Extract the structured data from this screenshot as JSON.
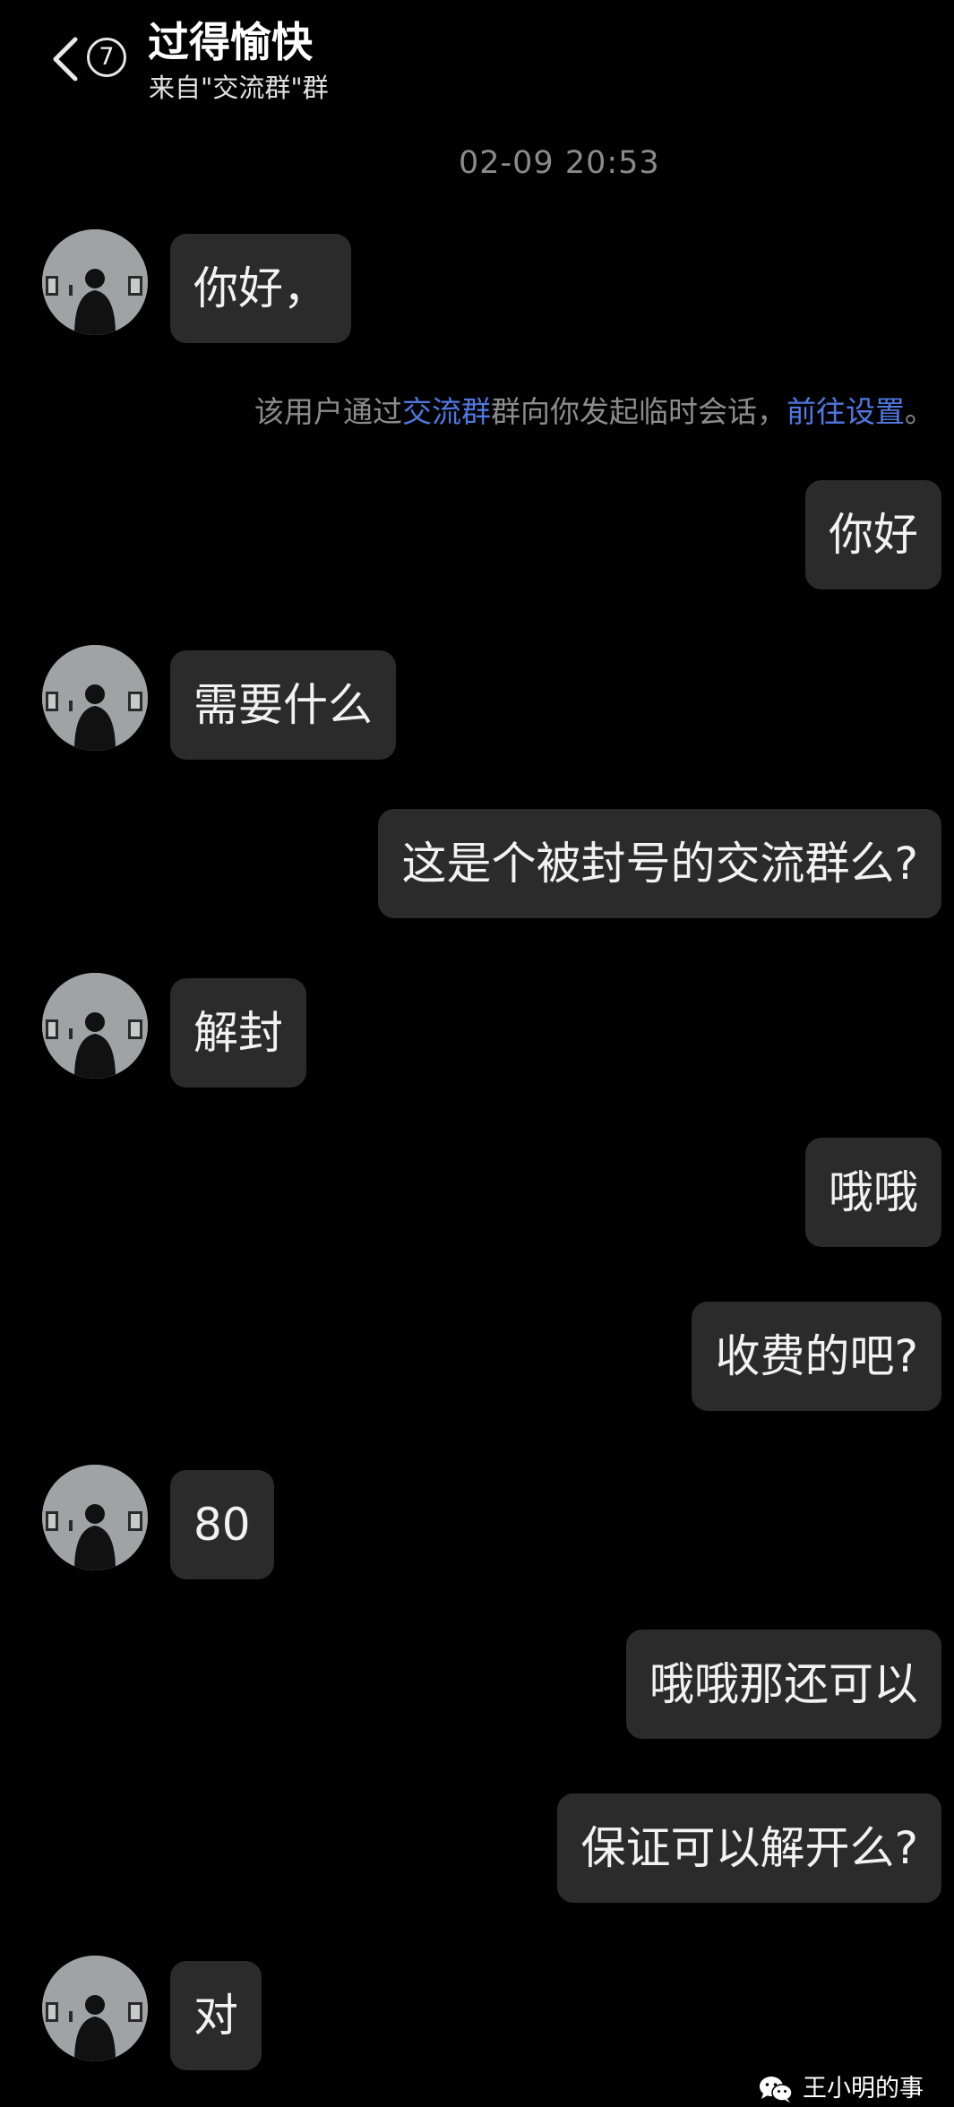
{
  "header": {
    "back_icon": "chevron-left-icon",
    "unread_count": "7",
    "title": "过得愉快",
    "subtitle": "来自\"交流群\"群"
  },
  "conversation": {
    "timestamp": "02-09 20:53",
    "notice": {
      "prefix": "该用户通过",
      "group_link": "交流群",
      "middle": "群向你发起临时会话，",
      "settings_link": "前往设置",
      "suffix": "。"
    },
    "messages": [
      {
        "side": "in",
        "text": "你好，"
      },
      {
        "side": "out",
        "text": "你好"
      },
      {
        "side": "in",
        "text": "需要什么"
      },
      {
        "side": "out",
        "text": "这是个被封号的交流群么?"
      },
      {
        "side": "in",
        "text": "解封"
      },
      {
        "side": "out",
        "text": "哦哦"
      },
      {
        "side": "out",
        "text": "收费的吧?"
      },
      {
        "side": "in",
        "text": "80"
      },
      {
        "side": "out",
        "text": "哦哦那还可以"
      },
      {
        "side": "out",
        "text": "保证可以解开么?"
      },
      {
        "side": "in",
        "text": "对"
      }
    ]
  },
  "watermark": {
    "icon": "wechat-icon",
    "text": "王小明的事"
  },
  "colors": {
    "background": "#000000",
    "bubble": "#2b2b2b",
    "link": "#4f78e0",
    "muted_text": "#8a8a8a"
  }
}
